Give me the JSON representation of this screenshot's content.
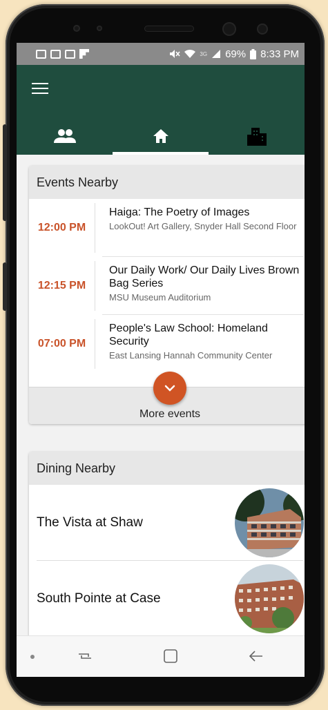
{
  "status_bar": {
    "battery_percent": "69%",
    "time": "8:33 PM",
    "network": "3G"
  },
  "tabs": [
    {
      "name": "people-icon",
      "active": false
    },
    {
      "name": "home-icon",
      "active": true
    },
    {
      "name": "building-icon",
      "active": false
    }
  ],
  "events": {
    "header": "Events Nearby",
    "items": [
      {
        "time": "12:00 PM",
        "title": "Haiga: The Poetry of Images",
        "place": "LookOut! Art Gallery, Snyder Hall Second Floor"
      },
      {
        "time": "12:15 PM",
        "title": "Our Daily Work/ Our Daily Lives Brown Bag Series",
        "place": "MSU Museum Auditorium"
      },
      {
        "time": "07:00 PM",
        "title": "People's Law School: Homeland Security",
        "place": "East Lansing Hannah Community Center"
      }
    ],
    "more_label": "More events"
  },
  "dining": {
    "header": "Dining Nearby",
    "items": [
      {
        "name": "The Vista at Shaw"
      },
      {
        "name": "South Pointe at Case"
      }
    ]
  },
  "colors": {
    "app_bar": "#1f4d3e",
    "accent": "#d05424",
    "time_text": "#c9532a"
  }
}
